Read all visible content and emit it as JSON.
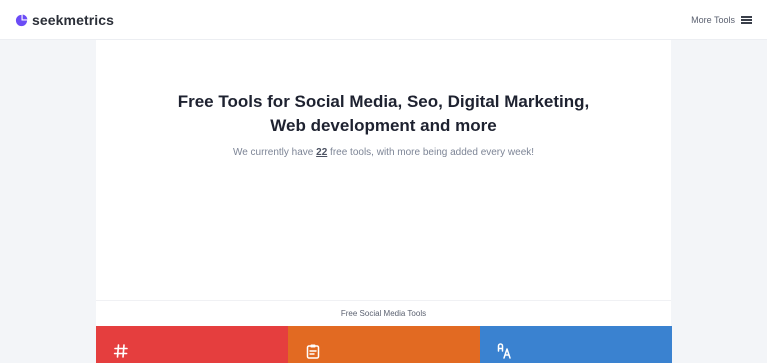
{
  "header": {
    "brand_name": "seekmetrics",
    "menu_label": "More Tools"
  },
  "hero": {
    "title_line1": "Free Tools for Social Media, Seo, Digital Marketing,",
    "title_line2": "Web development and more",
    "subtitle_prefix": "We currently have ",
    "tool_count": "22",
    "subtitle_suffix": " free tools, with more being added every week!"
  },
  "section": {
    "label": "Free Social Media Tools"
  },
  "cards": [
    {
      "icon": "hashtag-icon",
      "color": "#e53e3e"
    },
    {
      "icon": "clipboard-icon",
      "color": "#e26a22"
    },
    {
      "icon": "font-case-icon",
      "color": "#3a82d0"
    }
  ],
  "colors": {
    "brand_accent": "#6b4cf6",
    "page_background": "#f3f5f8"
  }
}
